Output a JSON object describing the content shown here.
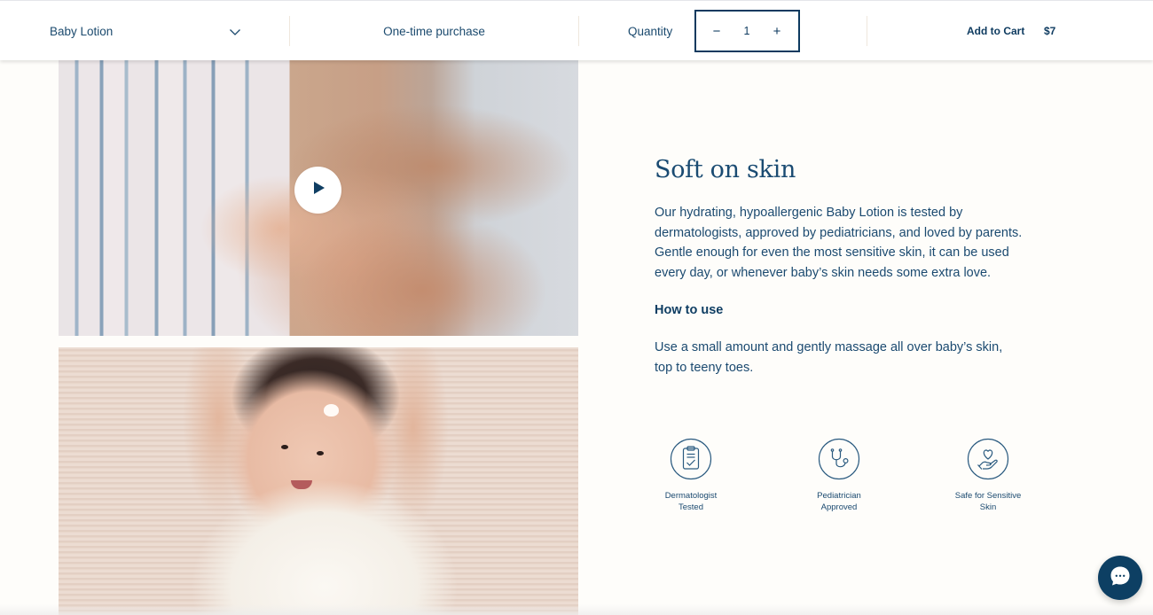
{
  "purchase_bar": {
    "variant": {
      "selected": "Baby Lotion",
      "icon": "chevron-down-icon"
    },
    "purchase_type": "One-time purchase",
    "quantity": {
      "label": "Quantity",
      "value": "1",
      "decrement": "−",
      "increment": "+"
    },
    "add_to_cart": "Add to Cart",
    "price": "$7"
  },
  "media": {
    "video": {
      "description": "Adult hands holding baby's hand",
      "play_icon": "play-icon"
    },
    "image": {
      "description": "Baby lying down with lotion on forehead"
    }
  },
  "content": {
    "heading": "Soft on skin",
    "description": "Our hydrating, hypoallergenic Baby Lotion is tested by dermatologists, approved by pediatricians, and loved by parents. Gentle enough for even the most sensitive skin, it can be used every day, or whenever baby’s skin needs some extra love.",
    "how_to_use_title": "How to use",
    "how_to_use_text": "Use a small amount and gently massage all over baby’s skin, top to teeny toes."
  },
  "badges": [
    {
      "icon": "clipboard-check-icon",
      "line1": "Dermatologist",
      "line2": "Tested"
    },
    {
      "icon": "stethoscope-icon",
      "line1": "Pediatrician",
      "line2": "Approved"
    },
    {
      "icon": "heart-hand-icon",
      "line1": "Safe for Sensitive",
      "line2": "Skin"
    }
  ],
  "chat": {
    "icon": "chat-bubble-icon"
  },
  "colors": {
    "brand_navy": "#0d3a5f",
    "text_blue": "#1b4a70",
    "page_background": "#fefdfa"
  }
}
